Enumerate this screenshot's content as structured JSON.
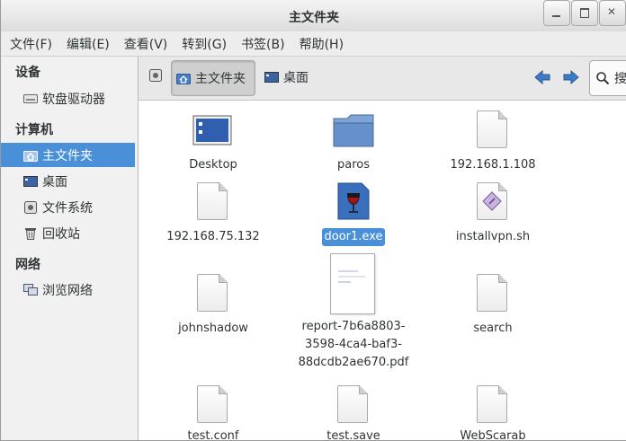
{
  "window": {
    "title": "主文件夹"
  },
  "menu": [
    "文件(F)",
    "编辑(E)",
    "查看(V)",
    "转到(G)",
    "书签(B)",
    "帮助(H)"
  ],
  "sidebar": {
    "devices_header": "设备",
    "devices": [
      {
        "label": "软盘驱动器",
        "icon": "floppy-icon"
      }
    ],
    "computer_header": "计算机",
    "computer": [
      {
        "label": "主文件夹",
        "icon": "home-folder-icon",
        "selected": true
      },
      {
        "label": "桌面",
        "icon": "desktop-icon"
      },
      {
        "label": "文件系统",
        "icon": "filesystem-icon"
      },
      {
        "label": "回收站",
        "icon": "trash-icon"
      }
    ],
    "network_header": "网络",
    "network": [
      {
        "label": "浏览网络",
        "icon": "network-icon"
      }
    ]
  },
  "toolbar": {
    "path_home": "主文件夹",
    "path_desktop": "桌面",
    "search_label": "搜"
  },
  "files": [
    {
      "name": "Desktop",
      "icon": "desktop-folder-icon"
    },
    {
      "name": "paros",
      "icon": "folder-icon"
    },
    {
      "name": "192.168.1.108",
      "icon": "text-file-icon"
    },
    {
      "name": "192.168.75.132",
      "icon": "text-file-icon"
    },
    {
      "name": "door1.exe",
      "icon": "wine-exe-icon",
      "selected": true
    },
    {
      "name": "installvpn.sh",
      "icon": "script-file-icon"
    },
    {
      "name": "johnshadow",
      "icon": "text-file-icon"
    },
    {
      "name_lines": [
        "report-7b6a8803-",
        "3598-4ca4-baf3-",
        "88dcdb2ae670.pdf"
      ],
      "icon": "pdf-thumbnail-icon"
    },
    {
      "name": "search",
      "icon": "text-file-icon"
    },
    {
      "name": "test.conf",
      "icon": "text-file-icon"
    },
    {
      "name": "test.save",
      "icon": "text-file-icon"
    },
    {
      "name": "WebScarab",
      "icon": "text-file-icon"
    }
  ]
}
